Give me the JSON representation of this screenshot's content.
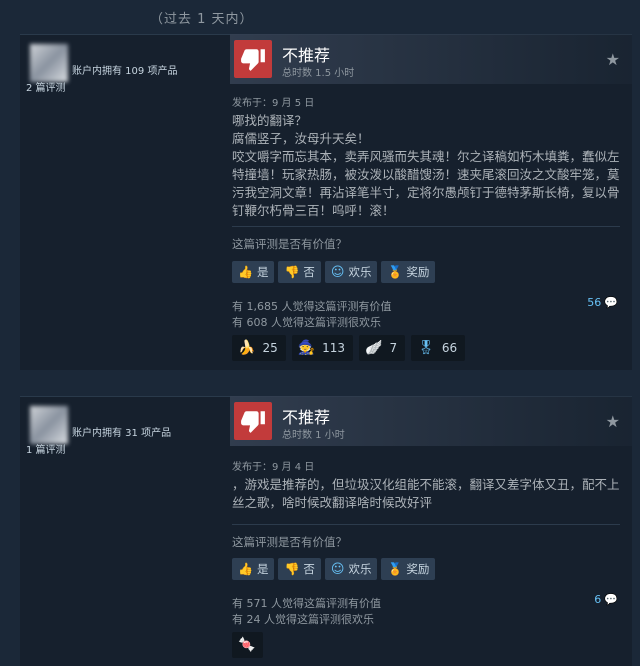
{
  "timeago": "（过去 1 天内）",
  "reviews": [
    {
      "author": {
        "products_owned": "账户内拥有 109 项产品",
        "review_count": "2 篇评测"
      },
      "rec_title": "不推荐",
      "hours": "总时数 1.5 小时",
      "posted": "发布于：9 月 5 日",
      "body": [
        "哪找的翻译？",
        "腐儒竖子，汝母升天矣！",
        "咬文嚼字而忘其本，卖弄风骚而失其魂！尔之译稿如朽木填粪，蠢似左特撞墙！玩家热肠，被汝泼以酸醋馊汤！速夹尾滚回汝之文酸牢笼，莫污我空洞文章！再沾译笔半寸，定将尔愚颅钉于德特茅斯长椅，复以骨钉鞭尔朽骨三百！呜呼！滚！"
      ],
      "helpful_q": "这篇评测是否有价值？",
      "votes": {
        "yes": "是",
        "no": "否",
        "funny": "欢乐",
        "award": "奖励"
      },
      "helpful_stat": "有 1,685 人觉得这篇评测有价值",
      "funny_stat": "有 608 人觉得这篇评测很欢乐",
      "comments": "56",
      "awards": [
        {
          "icon": "banana-award-icon",
          "count": "25"
        },
        {
          "icon": "character-award-icon",
          "count": "113"
        },
        {
          "icon": "wings-award-icon",
          "count": "7"
        },
        {
          "icon": "medal-award-icon",
          "count": "66"
        }
      ]
    },
    {
      "author": {
        "products_owned": "账户内拥有 31 项产品",
        "review_count": "1 篇评测"
      },
      "rec_title": "不推荐",
      "hours": "总时数 1 小时",
      "posted": "发布于：9 月 4 日",
      "body": [
        "，游戏是推荐的，但垃圾汉化组能不能滚，翻译又差字体又丑，配不上丝之歌，啥时候改翻译啥时候改好评"
      ],
      "helpful_q": "这篇评测是否有价值？",
      "votes": {
        "yes": "是",
        "no": "否",
        "funny": "欢乐",
        "award": "奖励"
      },
      "helpful_stat": "有 571 人觉得这篇评测有价值",
      "funny_stat": "有 24 人觉得这篇评测很欢乐",
      "comments": "6",
      "awards": [
        {
          "icon": "candy-award-icon",
          "count": ""
        }
      ]
    }
  ],
  "colors": {
    "thumb_down": "#c23b3b",
    "link": "#67c1f5",
    "award_gold": "#e5c12f"
  }
}
